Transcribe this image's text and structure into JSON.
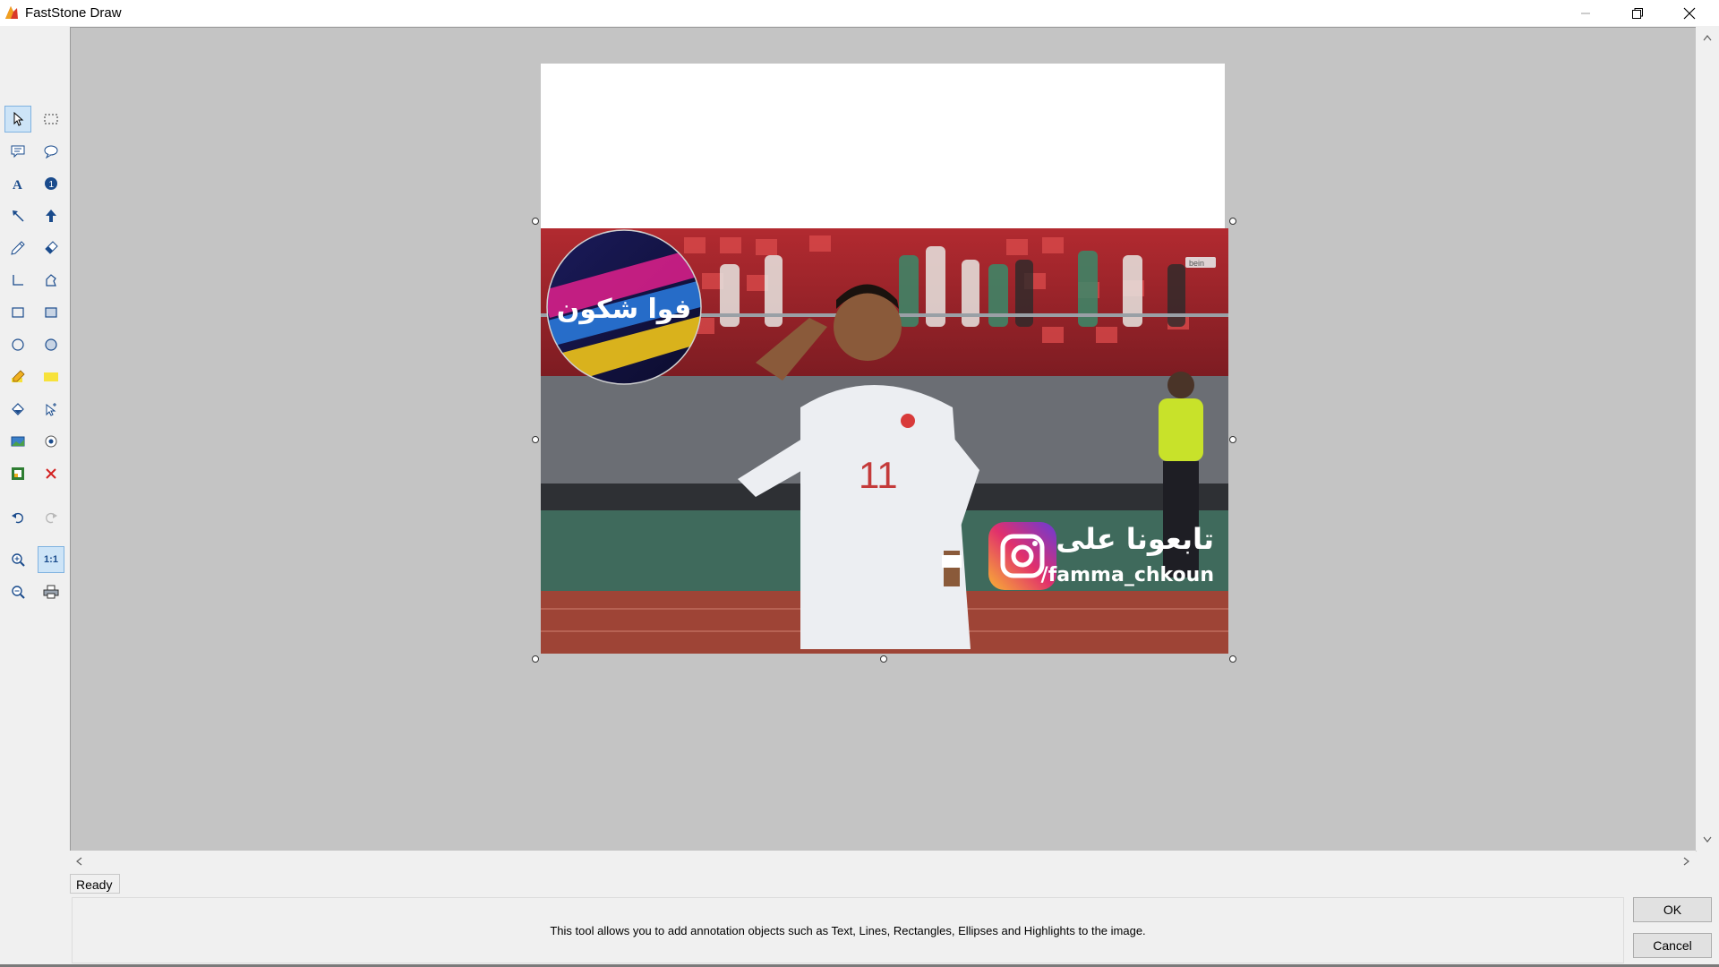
{
  "window": {
    "title": "FastStone Draw"
  },
  "toolbar": {
    "tools": [
      "select",
      "rectangle-select",
      "callout",
      "rounded-callout",
      "text",
      "numbered-step",
      "line-arrow",
      "block-arrow",
      "pen",
      "eraser",
      "polyline",
      "polygon",
      "rectangle",
      "filled-rectangle",
      "ellipse",
      "filled-ellipse",
      "highlighter",
      "highlight-box",
      "fill",
      "cursor-insert",
      "insert-image",
      "watermark",
      "border-effect",
      "delete",
      "undo",
      "redo",
      "zoom-in",
      "actual-size",
      "zoom-out",
      "print"
    ],
    "actual_size_label": "1:1",
    "active_tool": "select"
  },
  "image": {
    "logo_text": "فوا شكون",
    "broadcaster_logo": "bein",
    "jersey_number": "11",
    "follow_text": "تابعونا على",
    "handle_text": "/famma_chkoun"
  },
  "status": {
    "text": "Ready"
  },
  "info": {
    "text": "This tool allows you to add annotation objects such as Text, Lines, Rectangles, Ellipses and Highlights to the image."
  },
  "buttons": {
    "ok": "OK",
    "cancel": "Cancel"
  },
  "colors": {
    "canvas": "#c4c4c4",
    "chrome": "#f0f0f0",
    "selection": "#cde4f7"
  }
}
